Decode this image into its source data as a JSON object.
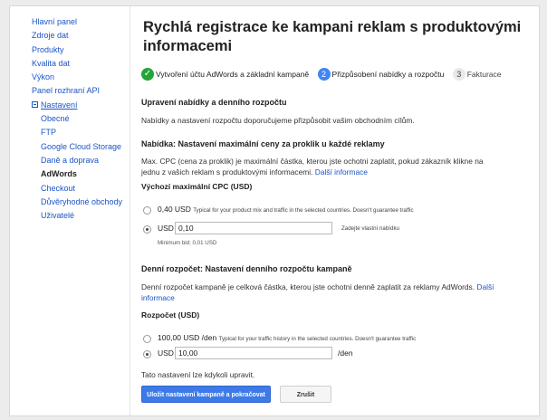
{
  "sidebar": {
    "items": [
      {
        "label": "Hlavní panel"
      },
      {
        "label": "Zdroje dat"
      },
      {
        "label": "Produkty"
      },
      {
        "label": "Kvalita dat"
      },
      {
        "label": "Výkon"
      },
      {
        "label": "Panel rozhraní API"
      },
      {
        "label": "Nastavení"
      },
      {
        "label": "Obecné"
      },
      {
        "label": "FTP"
      },
      {
        "label": "Google Cloud Storage"
      },
      {
        "label": "Daně a doprava"
      },
      {
        "label": "AdWords"
      },
      {
        "label": "Checkout"
      },
      {
        "label": "Důvěryhodné obchody"
      },
      {
        "label": "Uživatelé"
      }
    ],
    "active": "AdWords"
  },
  "page_title": "Rychlá registrace ke kampani reklam s produktovými informacemi",
  "steps": [
    {
      "label": "Vytvoření účtu AdWords a základní kampaně",
      "state": "done",
      "marker": "✓"
    },
    {
      "label": "Přizpůsobení nabídky a rozpočtu",
      "state": "current",
      "marker": "2"
    },
    {
      "label": "Fakturace",
      "state": "future",
      "marker": "3"
    }
  ],
  "bid_section": {
    "heading": "Upravení nabídky a denního rozpočtu",
    "intro": "Nabídky a nastavení rozpočtu doporučujeme přizpůsobit vašim obchodním cílům.",
    "subheading": "Nabídka: Nastavení maximální ceny za proklik u každé reklamy",
    "description": "Max. CPC (cena za proklik) je maximální částka, kterou jste ochotni zaplatit, pokud zákazník klikne na jednu z vašich reklam s produktovými informacemi.",
    "more_info": "Další informace",
    "field_label": "Výchozí maximální CPC (USD)",
    "option_recommended_value": "0,40 USD",
    "option_recommended_hint": "Typical for your product mix and traffic in the selected countries. Doesn't guarantee traffic",
    "option_custom_prefix": "USD",
    "custom_value": "0,10",
    "custom_hint": "Zadejte vlastní nabídku",
    "min_bid": "Minimum bid: 0,01 USD"
  },
  "budget_section": {
    "subheading": "Denní rozpočet: Nastavení denního rozpočtu kampaně",
    "description": "Denní rozpočet kampaně je celková částka, kterou jste ochotni denně zaplatit za reklamy AdWords.",
    "more_info": "Další informace",
    "field_label": "Rozpočet (USD)",
    "option_recommended_value": "100,00 USD /den",
    "option_recommended_hint": "Typical for your traffic history in the selected countries. Doesn't guarantee traffic",
    "option_custom_prefix": "USD",
    "custom_value": "10,00",
    "custom_suffix": "/den"
  },
  "footer_note": "Tato nastavení lze kdykoli upravit.",
  "buttons": {
    "save": "Uložit nastavení kampaně a pokračovat",
    "cancel": "Zrušit"
  },
  "colors": {
    "link": "#1a55c7",
    "primary_button": "#3d7ae8",
    "step_done": "#21a636",
    "step_current": "#4285f4"
  }
}
